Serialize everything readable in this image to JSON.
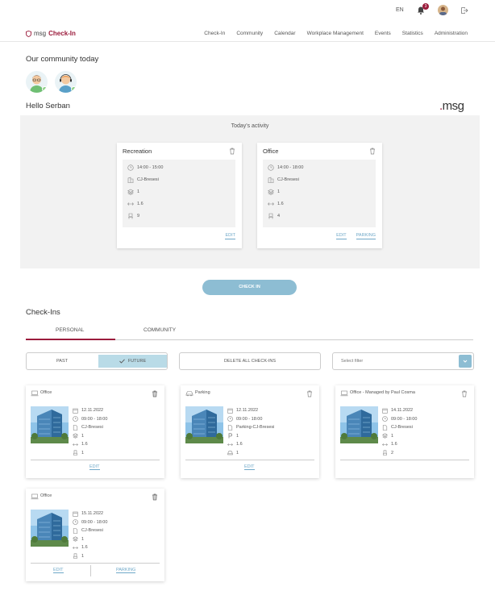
{
  "topbar": {
    "language": "EN",
    "notification_count": "3"
  },
  "brand": {
    "prefix": "msg",
    "name": "Check-In"
  },
  "nav": [
    "Check-In",
    "Community",
    "Calendar",
    "Workplace Management",
    "Events",
    "Statistics",
    "Administration"
  ],
  "community": {
    "heading": "Our community today"
  },
  "greeting": "Hello Serban",
  "logo": {
    "dot": ".",
    "text": "msg"
  },
  "activity": {
    "title": "Today's activity",
    "cards": [
      {
        "title": "Recreation",
        "time": "14:00 - 15:00",
        "building": "CJ-Bresesi",
        "floor": "1",
        "room": "1.6",
        "seat": "9",
        "links": [
          "EDIT"
        ]
      },
      {
        "title": "Office",
        "time": "14:00 - 18:00",
        "building": "CJ-Bresesi",
        "floor": "1",
        "room": "1.6",
        "seat": "4",
        "links": [
          "EDIT",
          "PARKING"
        ]
      }
    ]
  },
  "checkin_button": "CHECK IN",
  "checkins": {
    "heading": "Check-Ins",
    "tabs": [
      "PERSONAL",
      "COMMUNITY"
    ],
    "toggle": {
      "past": "PAST",
      "future": "FUTURE"
    },
    "delete_all": "DELETE ALL CHECK-INS",
    "filter_placeholder": "Select filter",
    "cards": [
      {
        "title": "Office",
        "date": "12.11.2022",
        "time": "09:00 - 18:00",
        "location": "CJ-Bresesi",
        "floor": "1",
        "room": "1.6",
        "seat": "1",
        "links": [
          "EDIT"
        ]
      },
      {
        "title": "Parking",
        "date": "12.11.2022",
        "time": "09:00 - 18:00",
        "location": "Parking-CJ-Bresesi",
        "floor": "1",
        "room": "1.6",
        "seat": "1",
        "links": [
          "EDIT"
        ]
      },
      {
        "title": "Office - Managed by Paul Cosma",
        "date": "14.11.2022",
        "time": "09:00 - 18:00",
        "location": "CJ-Bresesi",
        "floor": "1",
        "room": "1.6",
        "seat": "2",
        "links": []
      },
      {
        "title": "Office",
        "date": "15.11.2022",
        "time": "09:00 - 18:00",
        "location": "CJ-Bresesi",
        "floor": "1",
        "room": "1.6",
        "seat": "1",
        "links": [
          "EDIT",
          "PARKING"
        ]
      }
    ]
  },
  "colors": {
    "brand": "#9b1c3c",
    "accent": "#8dbdd3",
    "link": "#6fa8c8"
  }
}
